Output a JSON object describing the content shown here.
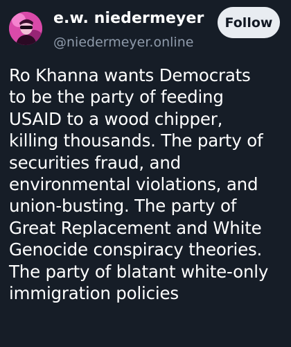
{
  "author": {
    "display_name": "e.w. niedermeyer",
    "handle": "@niedermeyer.online"
  },
  "follow_button": {
    "label": "Follow"
  },
  "post": {
    "lines": [
      "Ro Khanna wants Democrats",
      "to be the party of feeding",
      "USAID to a wood chipper,",
      "killing thousands. The party of",
      "securities fraud, and",
      "environmental violations, and",
      "union-busting. The party of",
      "Great Replacement and White",
      "Genocide conspiracy theories.",
      "The party of blatant white-only",
      "immigration policies"
    ]
  },
  "colors": {
    "background": "#161d27",
    "text": "#ffffff",
    "handle": "#8f9bab",
    "follow_button_bg": "#e8ecf1",
    "follow_button_text": "#111823"
  }
}
